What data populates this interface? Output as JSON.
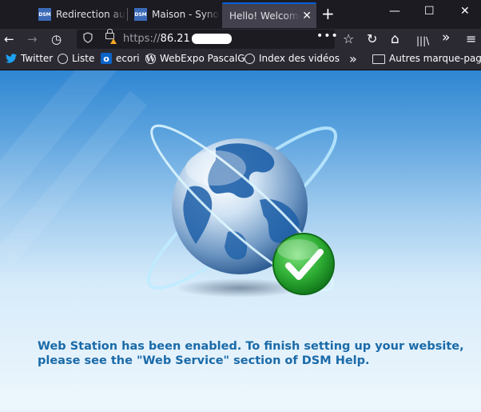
{
  "tabs": [
    {
      "label": "Redirection au",
      "favicon": "DSM"
    },
    {
      "label": "Maison - Syno",
      "favicon": "DSM"
    },
    {
      "label": "Hello! Welcome",
      "close": "✕"
    }
  ],
  "newtab_glyph": "+",
  "window_controls": {
    "minimize": "—",
    "maximize": "☐",
    "close": "✕"
  },
  "nav": {
    "back": "←",
    "forward": "→",
    "history": "◷",
    "url_scheme": "https://",
    "url_host": "86.21",
    "page_actions": "•••",
    "bookmark": "☆",
    "reload": "↻",
    "home": "⌂",
    "library": "|||\\",
    "overflow": "»",
    "menu": "≡"
  },
  "bookmarks": [
    {
      "label": "Twitter",
      "icon": "twitter-icon"
    },
    {
      "label": "Liste",
      "icon": "globe-icon"
    },
    {
      "label": "ecori",
      "icon": "outlook-icon",
      "glyph": "o"
    },
    {
      "label": "WebExpo PascalG",
      "icon": "wordpress-icon",
      "glyph": "W"
    },
    {
      "label": "Index des vidéos",
      "icon": "globe-icon"
    }
  ],
  "bookmarks_overflow": "»",
  "other_bookmarks": "Autres marque-pages",
  "message": {
    "line1": "Web Station has been enabled. To finish setting up your website,",
    "line2": "please see the \"Web Service\" section of DSM Help."
  },
  "colors": {
    "accent": "#0060df",
    "message": "#1a6aa8",
    "check_green": "#2fae34"
  }
}
